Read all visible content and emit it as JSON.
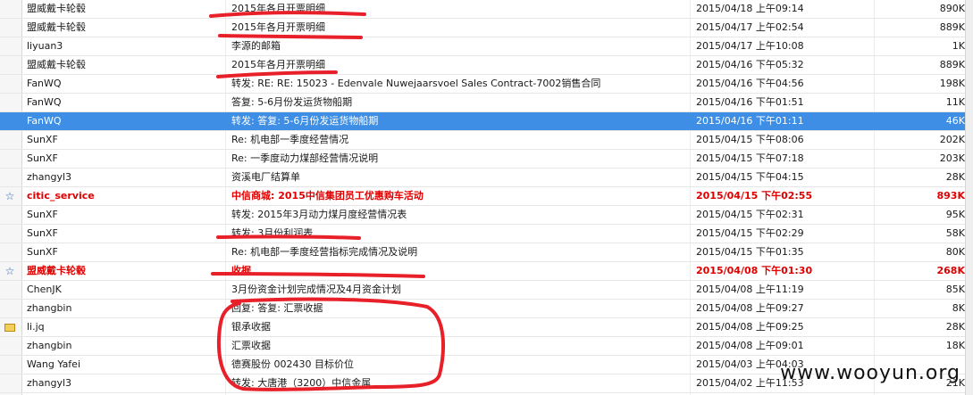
{
  "rows": [
    {
      "from": "盟威戴卡轮毂",
      "subject": "2015年各月开票明细",
      "date": "2015/04/18 上午09:14",
      "size": "890K",
      "flag": "",
      "style": ""
    },
    {
      "from": "盟威戴卡轮毂",
      "subject": "2015年各月开票明细",
      "date": "2015/04/17 上午02:54",
      "size": "889K",
      "flag": "",
      "style": ""
    },
    {
      "from": "liyuan3",
      "subject": "李源的邮箱",
      "date": "2015/04/17 上午10:08",
      "size": "1K",
      "flag": "",
      "style": ""
    },
    {
      "from": "盟威戴卡轮毂",
      "subject": "2015年各月开票明细",
      "date": "2015/04/16 下午05:32",
      "size": "889K",
      "flag": "",
      "style": ""
    },
    {
      "from": "FanWQ",
      "subject": "转发: RE: RE: 15023 - Edenvale Nuwejaarsvoel Sales Contract-7002销售合同",
      "date": "2015/04/16 下午04:56",
      "size": "198K",
      "flag": "",
      "style": ""
    },
    {
      "from": "FanWQ",
      "subject": "答复: 5-6月份发运货物船期",
      "date": "2015/04/16 下午01:51",
      "size": "11K",
      "flag": "",
      "style": ""
    },
    {
      "from": "FanWQ",
      "subject": "转发: 答复: 5-6月份发运货物船期",
      "date": "2015/04/16 下午01:11",
      "size": "46K",
      "flag": "",
      "style": "selected"
    },
    {
      "from": "SunXF",
      "subject": "Re: 机电部一季度经营情况",
      "date": "2015/04/15 下午08:06",
      "size": "202K",
      "flag": "",
      "style": ""
    },
    {
      "from": "SunXF",
      "subject": "Re: 一季度动力煤部经营情况说明",
      "date": "2015/04/15 下午07:18",
      "size": "203K",
      "flag": "",
      "style": ""
    },
    {
      "from": "zhangyl3",
      "subject": "资溪电厂结算单",
      "date": "2015/04/15 下午04:15",
      "size": "28K",
      "flag": "",
      "style": ""
    },
    {
      "from": "citic_service",
      "subject": "中信商城: 2015中信集团员工优惠购车活动",
      "date": "2015/04/15 下午02:55",
      "size": "893K",
      "flag": "☆",
      "style": "red"
    },
    {
      "from": "SunXF",
      "subject": "转发: 2015年3月动力煤月度经营情况表",
      "date": "2015/04/15 下午02:31",
      "size": "95K",
      "flag": "",
      "style": ""
    },
    {
      "from": "SunXF",
      "subject": "转发: 3月份利润表",
      "date": "2015/04/15 下午02:29",
      "size": "58K",
      "flag": "",
      "style": ""
    },
    {
      "from": "SunXF",
      "subject": "Re: 机电部一季度经营指标完成情况及说明",
      "date": "2015/04/15 下午01:35",
      "size": "80K",
      "flag": "",
      "style": ""
    },
    {
      "from": "盟威戴卡轮毂",
      "subject": "收据",
      "date": "2015/04/08 下午01:30",
      "size": "268K",
      "flag": "☆",
      "style": "red"
    },
    {
      "from": "ChenJK",
      "subject": "3月份资金计划完成情况及4月资金计划",
      "date": "2015/04/08 上午11:19",
      "size": "85K",
      "flag": "",
      "style": ""
    },
    {
      "from": "zhangbin",
      "subject": "回复: 答复: 汇票收据",
      "date": "2015/04/08 上午09:27",
      "size": "8K",
      "flag": "",
      "style": ""
    },
    {
      "from": "li.jq",
      "subject": "银承收据",
      "date": "2015/04/08 上午09:25",
      "size": "28K",
      "flag": "envelope",
      "style": ""
    },
    {
      "from": "zhangbin",
      "subject": "汇票收据",
      "date": "2015/04/08 上午09:01",
      "size": "18K",
      "flag": "",
      "style": ""
    },
    {
      "from": "Wang Yafei",
      "subject": "德赛股份 002430 目标价位",
      "date": "2015/04/03 上午04:03",
      "size": "",
      "flag": "",
      "style": ""
    },
    {
      "from": "zhangyl3",
      "subject": "转发: 大唐港（3200）中信金属",
      "date": "2015/04/02 上午11:53",
      "size": "21K",
      "flag": "",
      "style": ""
    }
  ],
  "watermark": "www.wooyun.org",
  "colors": {
    "selected": "#3d8ee4",
    "flagged_text": "#e00000",
    "annotation": "#e8202a",
    "star": "#2e62b8"
  }
}
